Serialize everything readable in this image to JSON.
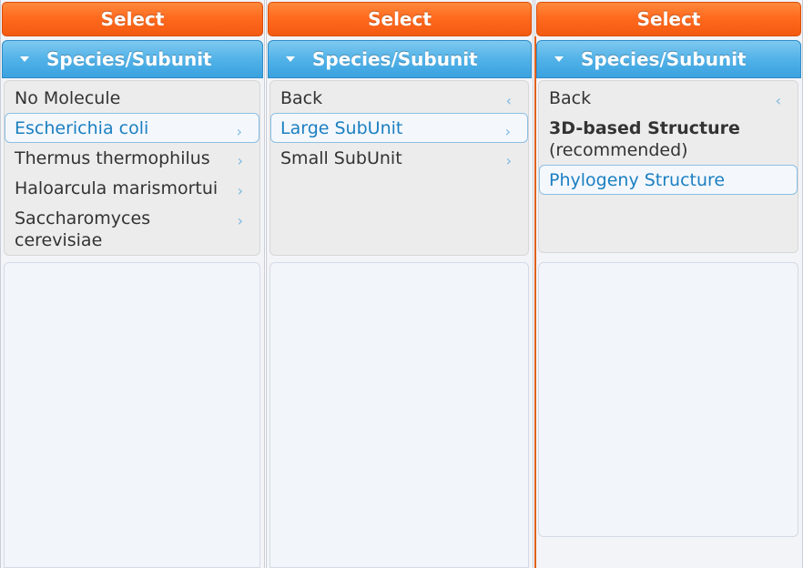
{
  "panels": [
    {
      "select_label": "Select",
      "section_title": "Species/Subunit",
      "items": [
        {
          "label": "No Molecule"
        },
        {
          "label": "Escherichia coli"
        },
        {
          "label": "Thermus thermophilus"
        },
        {
          "label": "Haloarcula marismortui"
        },
        {
          "label": "Saccharomyces cerevisiae"
        }
      ]
    },
    {
      "select_label": "Select",
      "section_title": "Species/Subunit",
      "items": [
        {
          "label": "Back"
        },
        {
          "label": "Large SubUnit"
        },
        {
          "label": "Small SubUnit"
        }
      ]
    },
    {
      "select_label": "Select",
      "section_title": "Species/Subunit",
      "items": [
        {
          "label": "Back"
        },
        {
          "label": "3D-based Structure",
          "note": "(recommended)"
        },
        {
          "label": "Phylogeny Structure"
        }
      ]
    }
  ],
  "icons": {
    "chevron_right": "›",
    "chevron_left": "‹",
    "triangle_down": "triangle-down-icon"
  },
  "colors": {
    "select_orange": "#ff6a1f",
    "header_blue": "#52b2e8",
    "selected_text": "#1b7fc1"
  }
}
